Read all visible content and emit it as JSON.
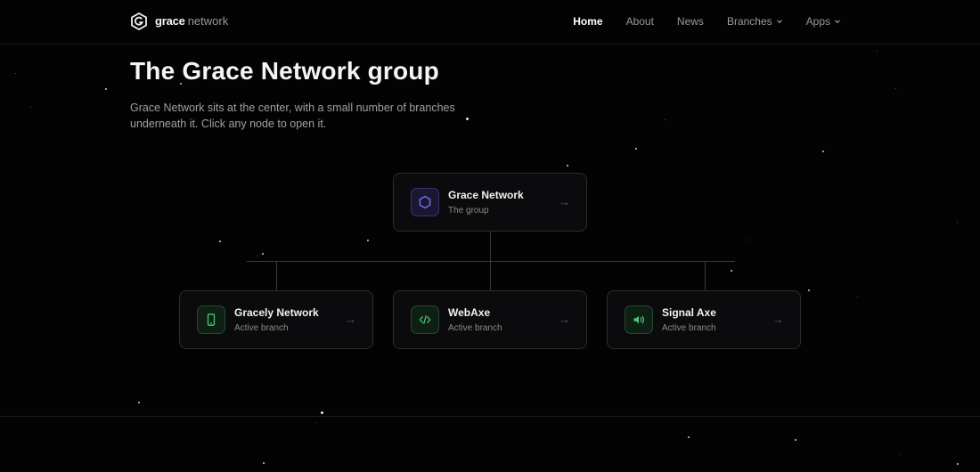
{
  "brand": {
    "name": "grace",
    "suffix": "network"
  },
  "nav": {
    "items": [
      {
        "label": "Home",
        "active": true
      },
      {
        "label": "About"
      },
      {
        "label": "News"
      },
      {
        "label": "Branches",
        "has_dropdown": true
      },
      {
        "label": "Apps",
        "has_dropdown": true
      }
    ]
  },
  "page": {
    "title": "The Grace Network group",
    "intro": "Grace Network sits at the center, with a small number of branches underneath it. Click any node to open it."
  },
  "tree": {
    "root": {
      "title": "Grace Network",
      "subtitle": "The group",
      "icon": "hexagon-icon",
      "arrow": "→"
    },
    "branches": [
      {
        "title": "Gracely Network",
        "subtitle": "Active branch",
        "icon": "phone-icon",
        "arrow": "→"
      },
      {
        "title": "WebAxe",
        "subtitle": "Active branch",
        "icon": "code-icon",
        "arrow": "→"
      },
      {
        "title": "Signal Axe",
        "subtitle": "Active branch",
        "icon": "speaker-icon",
        "arrow": "→"
      }
    ]
  },
  "colors": {
    "background": "#030303",
    "root_accent": "#7c6ff0",
    "branch_accent": "#4fc47a"
  }
}
